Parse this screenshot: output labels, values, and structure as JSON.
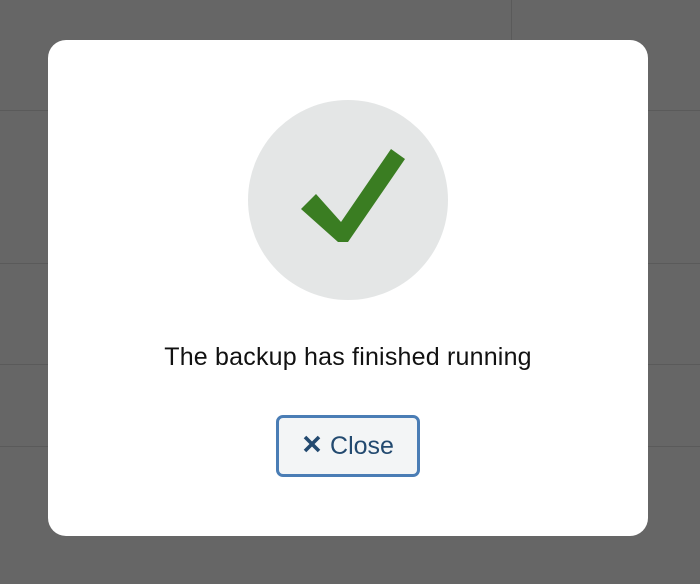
{
  "dialog": {
    "message": "The backup has finished running",
    "close_label": "Close",
    "status_icon": "checkmark-icon",
    "close_icon": "close-x-icon"
  },
  "colors": {
    "backdrop": "#666666",
    "modal_background": "#ffffff",
    "icon_circle": "#e4e6e6",
    "checkmark": "#3a7d22",
    "button_border": "#4a7db5",
    "button_text": "#234a70"
  }
}
